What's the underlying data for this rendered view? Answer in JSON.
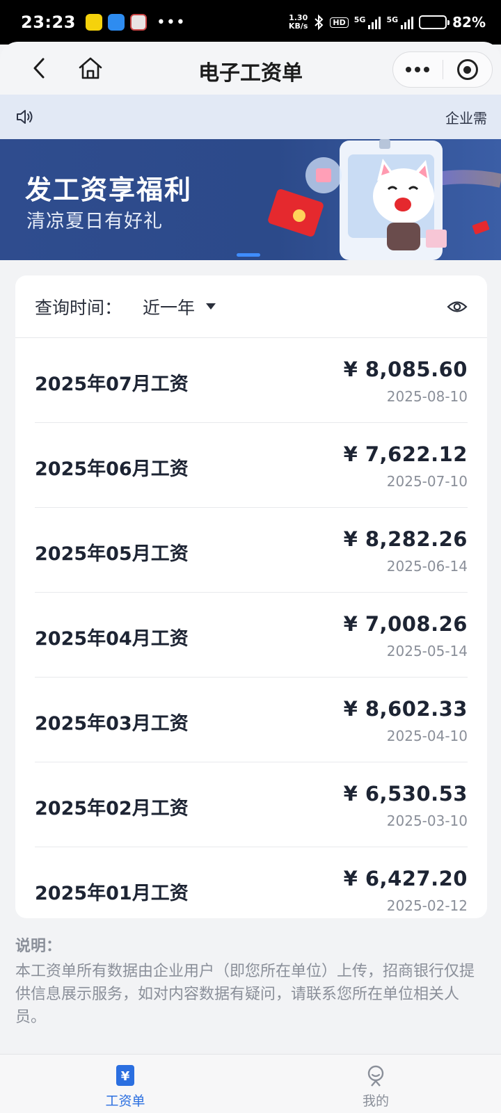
{
  "status_bar": {
    "time": "23:23",
    "net_speed_value": "1.30",
    "net_speed_unit": "KB/s",
    "hd_label": "HD",
    "signal_label_1": "5G",
    "signal_label_2": "5G",
    "battery_percent": "82%",
    "battery_level": 0.82
  },
  "header": {
    "title": "电子工资单",
    "back_icon": "chevron-left-icon",
    "home_icon": "home-icon"
  },
  "notice": {
    "icon": "speaker-icon",
    "text": "企业需"
  },
  "banner": {
    "title": "发工资享福利",
    "subtitle": "清凉夏日有好礼"
  },
  "filter": {
    "label": "查询时间：",
    "value": "近一年"
  },
  "salaries": [
    {
      "title": "2025年07月工资",
      "amount": "¥ 8,085.60",
      "date": "2025-08-10"
    },
    {
      "title": "2025年06月工资",
      "amount": "¥ 7,622.12",
      "date": "2025-07-10"
    },
    {
      "title": "2025年05月工资",
      "amount": "¥ 8,282.26",
      "date": "2025-06-14"
    },
    {
      "title": "2025年04月工资",
      "amount": "¥ 7,008.26",
      "date": "2025-05-14"
    },
    {
      "title": "2025年03月工资",
      "amount": "¥ 8,602.33",
      "date": "2025-04-10"
    },
    {
      "title": "2025年02月工资",
      "amount": "¥ 6,530.53",
      "date": "2025-03-10"
    },
    {
      "title": "2025年01月工资",
      "amount": "¥ 6,427.20",
      "date": "2025-02-12"
    }
  ],
  "note": {
    "title": "说明：",
    "body": "本工资单所有数据由企业用户（即您所在单位）上传，招商银行仅提供信息展示服务，如对内容数据有疑问，请联系您所在单位相关人员。"
  },
  "tabbar": {
    "tabs": [
      {
        "label": "工资单",
        "active": true
      },
      {
        "label": "我的",
        "active": false
      }
    ]
  },
  "colors": {
    "accent": "#2b6fe0",
    "banner_bg": "#2f4c8e",
    "notice_bg": "#e2e9f5"
  }
}
